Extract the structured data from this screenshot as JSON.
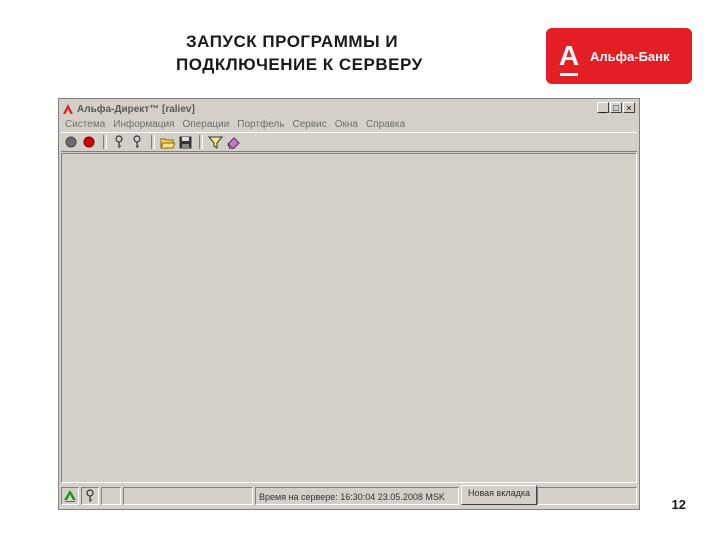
{
  "slide": {
    "title_line1": "ЗАПУСК ПРОГРАММЫ И",
    "title_line2": "ПОДКЛЮЧЕНИЕ К СЕРВЕРУ",
    "page_number": "12"
  },
  "brand": {
    "letter": "А",
    "name": "Альфа-Банк",
    "color": "#e31e24"
  },
  "window": {
    "title": "Альфа-Директ™ [raliev]",
    "controls": [
      "_",
      "□",
      "×"
    ]
  },
  "menu": [
    "Система",
    "Информация",
    "Операции",
    "Портфель",
    "Сервис",
    "Окна",
    "Справка"
  ],
  "toolbar": {
    "buttons": [
      "disconnect-icon",
      "connect-icon",
      "key-icon",
      "key-icon",
      "open-folder-icon",
      "save-icon",
      "filter-icon",
      "eraser-icon"
    ]
  },
  "statusbar": {
    "server_time": "Время на сервере: 16:30:04 23.05.2008 MSK",
    "new_tab": "Новая вкладка"
  }
}
